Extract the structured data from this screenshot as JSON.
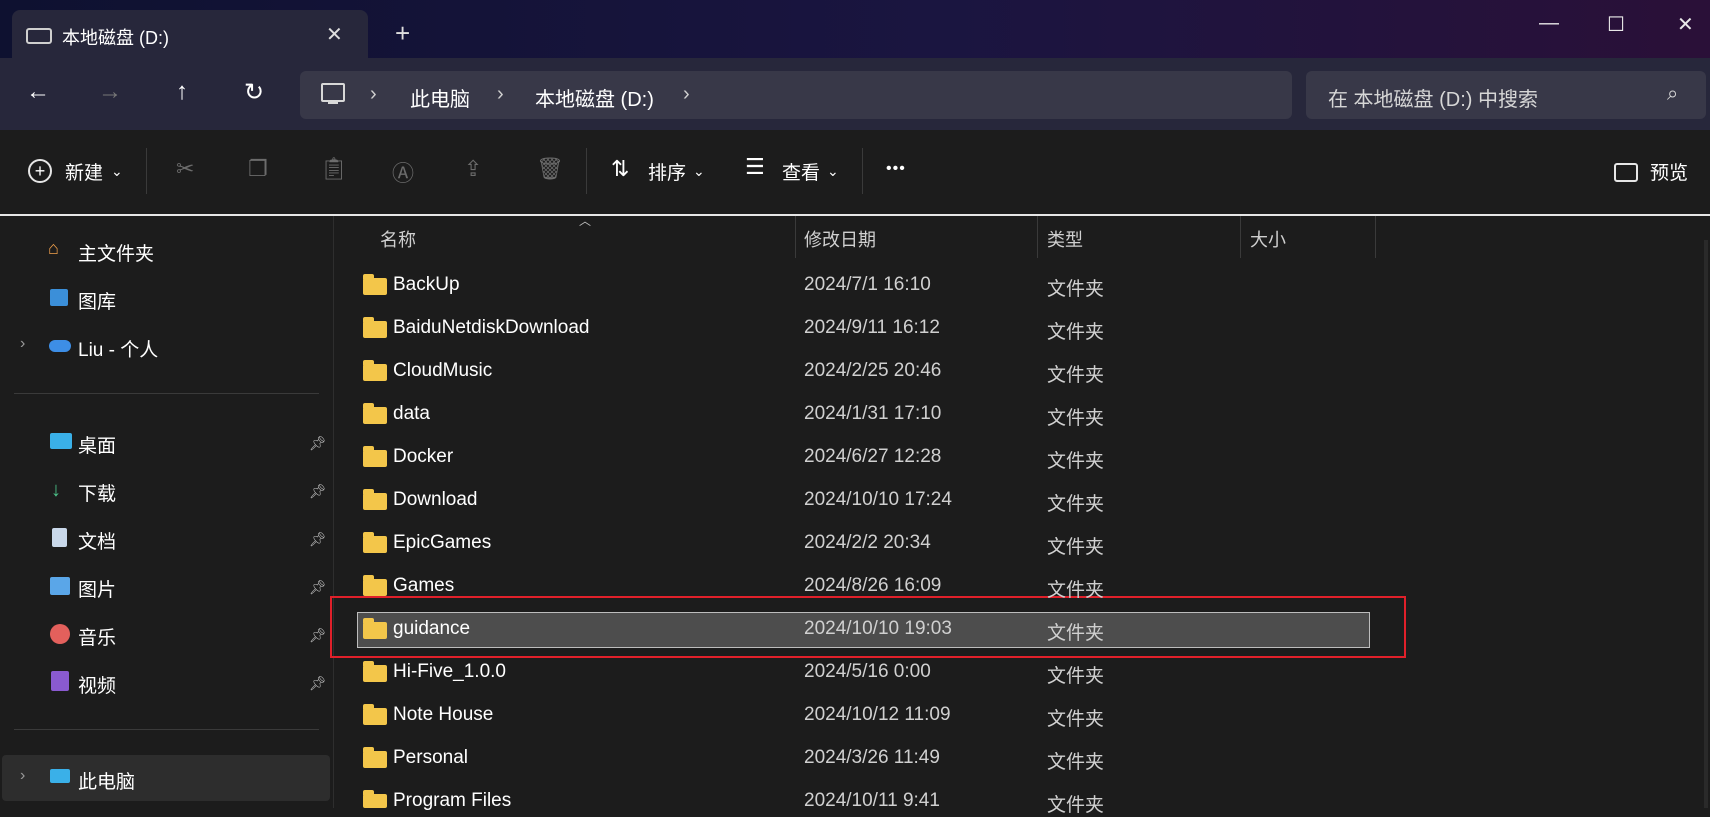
{
  "tab": {
    "title": "本地磁盘 (D:)",
    "close": "✕",
    "add": "+"
  },
  "window": {
    "minimize": "—",
    "maximize": "☐",
    "close": "✕"
  },
  "nav": {
    "back": "←",
    "forward": "→",
    "up": "↑",
    "refresh": "↻"
  },
  "address": {
    "computer": "此电脑",
    "drive": "本地磁盘 (D:)",
    "sep": "›"
  },
  "search": {
    "placeholder": "在 本地磁盘 (D:) 中搜索"
  },
  "toolbar": {
    "new": "新建",
    "sort": "排序",
    "view": "查看",
    "more": "•••",
    "preview": "预览"
  },
  "sidebar": {
    "top": [
      {
        "label": "主文件夹",
        "icon": "home-icon"
      },
      {
        "label": "图库",
        "icon": "gallery-icon"
      },
      {
        "label": "Liu - 个人",
        "icon": "cloud-icon"
      }
    ],
    "pinned": [
      {
        "label": "桌面",
        "icon": "desktop-icon"
      },
      {
        "label": "下载",
        "icon": "download-icon"
      },
      {
        "label": "文档",
        "icon": "document-icon"
      },
      {
        "label": "图片",
        "icon": "pictures-icon"
      },
      {
        "label": "音乐",
        "icon": "music-icon"
      },
      {
        "label": "视频",
        "icon": "video-icon"
      }
    ],
    "thispc": "此电脑"
  },
  "columns": {
    "name": "名称",
    "date": "修改日期",
    "type": "类型",
    "size": "大小"
  },
  "files": [
    {
      "name": "BackUp",
      "date": "2024/7/1 16:10",
      "type": "文件夹"
    },
    {
      "name": "BaiduNetdiskDownload",
      "date": "2024/9/11 16:12",
      "type": "文件夹"
    },
    {
      "name": "CloudMusic",
      "date": "2024/2/25 20:46",
      "type": "文件夹"
    },
    {
      "name": "data",
      "date": "2024/1/31 17:10",
      "type": "文件夹"
    },
    {
      "name": "Docker",
      "date": "2024/6/27 12:28",
      "type": "文件夹"
    },
    {
      "name": "Download",
      "date": "2024/10/10 17:24",
      "type": "文件夹"
    },
    {
      "name": "EpicGames",
      "date": "2024/2/2 20:34",
      "type": "文件夹"
    },
    {
      "name": "Games",
      "date": "2024/8/26 16:09",
      "type": "文件夹"
    },
    {
      "name": "guidance",
      "date": "2024/10/10 19:03",
      "type": "文件夹"
    },
    {
      "name": "Hi-Five_1.0.0",
      "date": "2024/5/16 0:00",
      "type": "文件夹"
    },
    {
      "name": "Note House",
      "date": "2024/10/12 11:09",
      "type": "文件夹"
    },
    {
      "name": "Personal",
      "date": "2024/3/26 11:49",
      "type": "文件夹"
    },
    {
      "name": "Program Files",
      "date": "2024/10/11 9:41",
      "type": "文件夹"
    }
  ],
  "colors": {
    "folder": "#f3c64a",
    "highlight": "#e0202a",
    "accent": "#4aa3f0"
  }
}
